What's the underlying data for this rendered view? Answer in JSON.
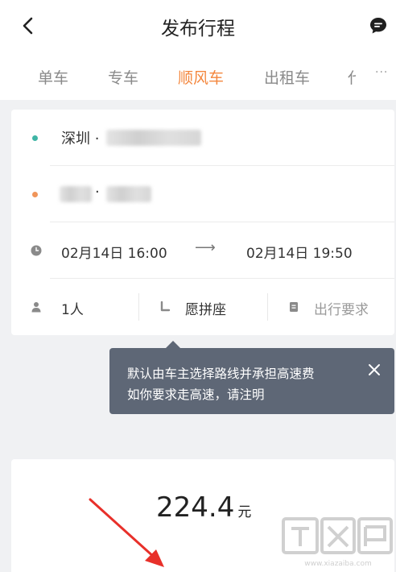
{
  "header": {
    "title": "发布行程"
  },
  "tabs": {
    "items": [
      "单车",
      "专车",
      "顺风车",
      "出租车"
    ],
    "partial": "代",
    "more": "···"
  },
  "trip": {
    "origin": "深圳 ·",
    "destination": "·",
    "depart_time": "02月14日 16:00",
    "arrow": "⟶",
    "arrive_time": "02月14日 19:50",
    "passengers": "1人",
    "carpool": "愿拼座",
    "requirements": "出行要求"
  },
  "tooltip": {
    "line1": "默认由车主选择路线并承担高速费",
    "line2": "如你要求走高速，请注明"
  },
  "price": {
    "amount": "224.4",
    "unit": "元"
  },
  "watermark": {
    "text": "下载吧",
    "site": "www.xiazaiba.com"
  },
  "colors": {
    "accent": "#f4873e",
    "origin_dot": "#3fb5a5",
    "dest_dot": "#f0955a",
    "tooltip_bg": "#5e6776"
  }
}
